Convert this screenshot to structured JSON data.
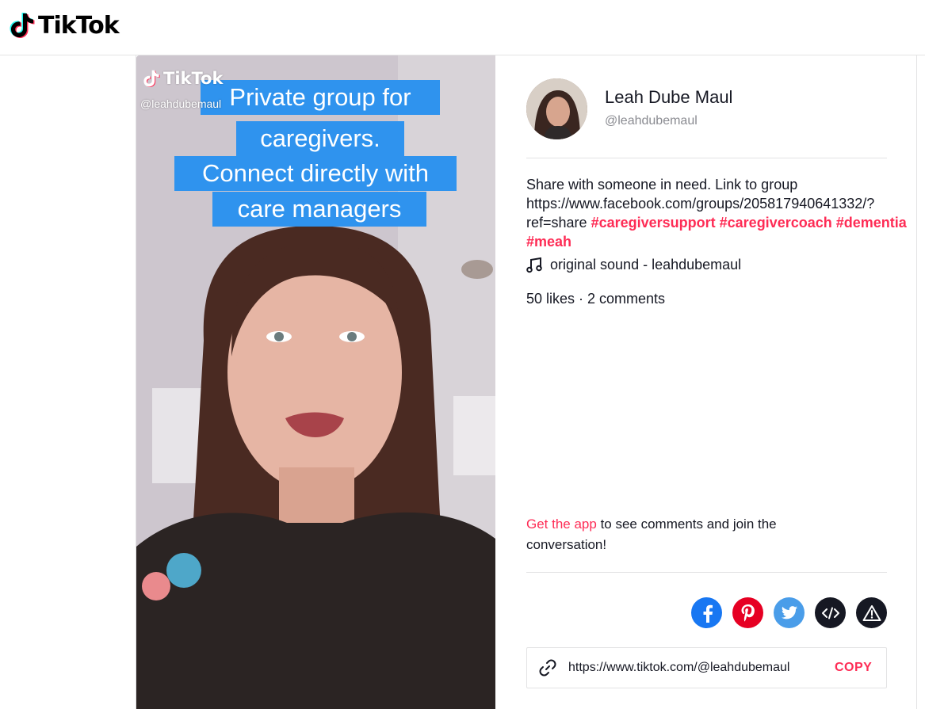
{
  "header": {
    "logo_text": "TikTok"
  },
  "video": {
    "watermark_text": "TikTok",
    "watermark_handle": "@leahdubemaul",
    "caption_lines": [
      "Private group for",
      "caregivers.",
      "Connect directly with",
      "care managers"
    ]
  },
  "author": {
    "name": "Leah Dube Maul",
    "handle": "@leahdubemaul"
  },
  "description": {
    "text": "Share with someone in need. Link to group https://www.facebook.com/groups/205817940641332/?ref=share",
    "hashtags": [
      "#caregiversupport",
      "#caregivercoach",
      "#dementia",
      "#meah"
    ]
  },
  "sound": {
    "icon": "music-note-icon",
    "label": "original sound - leahdubemaul"
  },
  "stats": {
    "text": "50 likes · 2 comments"
  },
  "get_app": {
    "link_text": "Get the app",
    "rest_text": " to see comments and join the conversation!"
  },
  "share": {
    "buttons": [
      {
        "name": "facebook",
        "icon": "facebook-icon",
        "color": "#1877f2"
      },
      {
        "name": "pinterest",
        "icon": "pinterest-icon",
        "color": "#e60023"
      },
      {
        "name": "twitter",
        "icon": "twitter-icon",
        "color": "#4a9de9"
      },
      {
        "name": "embed",
        "icon": "embed-code-icon",
        "color": "#161823"
      },
      {
        "name": "report",
        "icon": "warning-icon",
        "color": "#161823"
      }
    ]
  },
  "copy_link": {
    "url": "https://www.tiktok.com/@leahdubemaul",
    "button_label": "COPY"
  },
  "colors": {
    "accent": "#fe2c55",
    "caption_bg": "#2f93ee"
  }
}
